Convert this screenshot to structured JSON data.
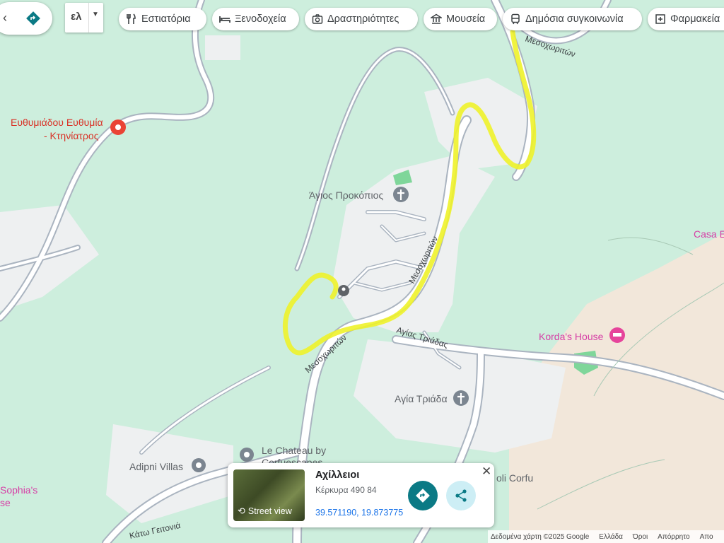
{
  "toolbar": {
    "back_glyph": "‹",
    "language_label": "ελ",
    "categories": [
      {
        "label": "Εστιατόρια",
        "icon": "restaurant-icon"
      },
      {
        "label": "Ξενοδοχεία",
        "icon": "hotel-icon"
      },
      {
        "label": "Δραστηριότητες",
        "icon": "camera-icon"
      },
      {
        "label": "Μουσεία",
        "icon": "museum-icon"
      },
      {
        "label": "Δημόσια συγκοινωνία",
        "icon": "transit-icon"
      },
      {
        "label": "Φαρμακεία",
        "icon": "pharmacy-icon"
      }
    ]
  },
  "map": {
    "road_labels": [
      "Μεσοχωριτών",
      "Μεσοχωριτών",
      "Μεσοχωριτών",
      "Αγίας Τριάδας",
      "Κάτω Γειτονιά"
    ],
    "places": [
      {
        "name": "Ευθυμιάδου Ευθυμία",
        "name2": "- Κτηνίατρος",
        "kind": "red-pin"
      },
      {
        "name": "Άγιος Προκόπιος",
        "kind": "church"
      },
      {
        "name": "Αγία Τριάδα",
        "kind": "church"
      },
      {
        "name": "Korda's House",
        "kind": "hotel-pink"
      },
      {
        "name": "Casa E",
        "kind": "hotel-pink"
      },
      {
        "name": "Adipni Villas",
        "kind": "poi"
      },
      {
        "name": "Le Chateau by",
        "name2": "Corfuescapes",
        "kind": "poi"
      },
      {
        "name": "oli Corfu",
        "kind": "poi"
      },
      {
        "name": "Sophia's",
        "name2": "se",
        "kind": "hotel-pink"
      }
    ],
    "colors": {
      "land": "#cdeedd",
      "road": "#ffffff",
      "road_casing": "#aab4c0",
      "highlight": "#f0f020",
      "urban": "#eef0f1",
      "sand": "#f2e7da"
    }
  },
  "place_card": {
    "title": "Αχίλλειοι",
    "subtitle": "Κέρκυρα 490 84",
    "coordinates": "39.571190, 19.873775",
    "street_view_label": "Street view"
  },
  "footer": {
    "items": [
      "Δεδομένα χάρτη ©2025 Google",
      "Ελλάδα",
      "Όροι",
      "Απόρρητο",
      "Απο"
    ]
  }
}
